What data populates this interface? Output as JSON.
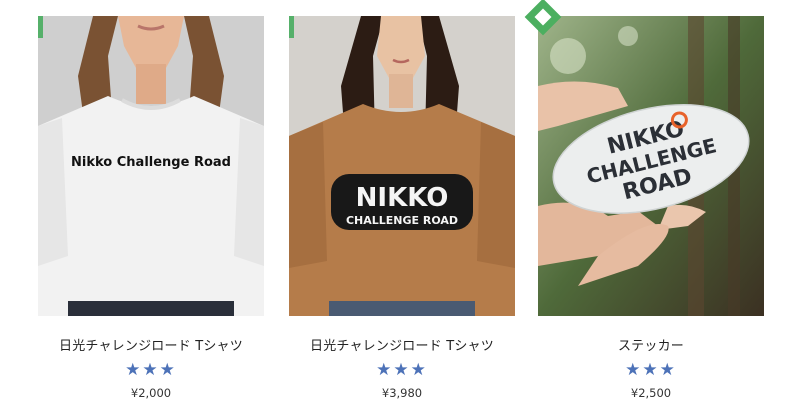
{
  "products": [
    {
      "title": "日光チャレンジロード Tシャツ",
      "rating": 3,
      "price": "¥2,000",
      "shirt_text": "Nikko Challenge Road"
    },
    {
      "title": "日光チャレンジロード Tシャツ",
      "rating": 3,
      "price": "¥3,980",
      "shirt_text_1": "NIKKO",
      "shirt_text_2": "CHALLENGE ROAD"
    },
    {
      "title": "ステッカー",
      "rating": 3,
      "price": "¥2,500",
      "sticker_line_1": "NIKKO",
      "sticker_line_2": "CHALLENGE",
      "sticker_line_3": "ROAD"
    }
  ],
  "star_glyphs": "★★★",
  "colors": {
    "star": "#4d72b8",
    "accent_green": "#4caf60",
    "sticker_orange": "#e8622a"
  }
}
